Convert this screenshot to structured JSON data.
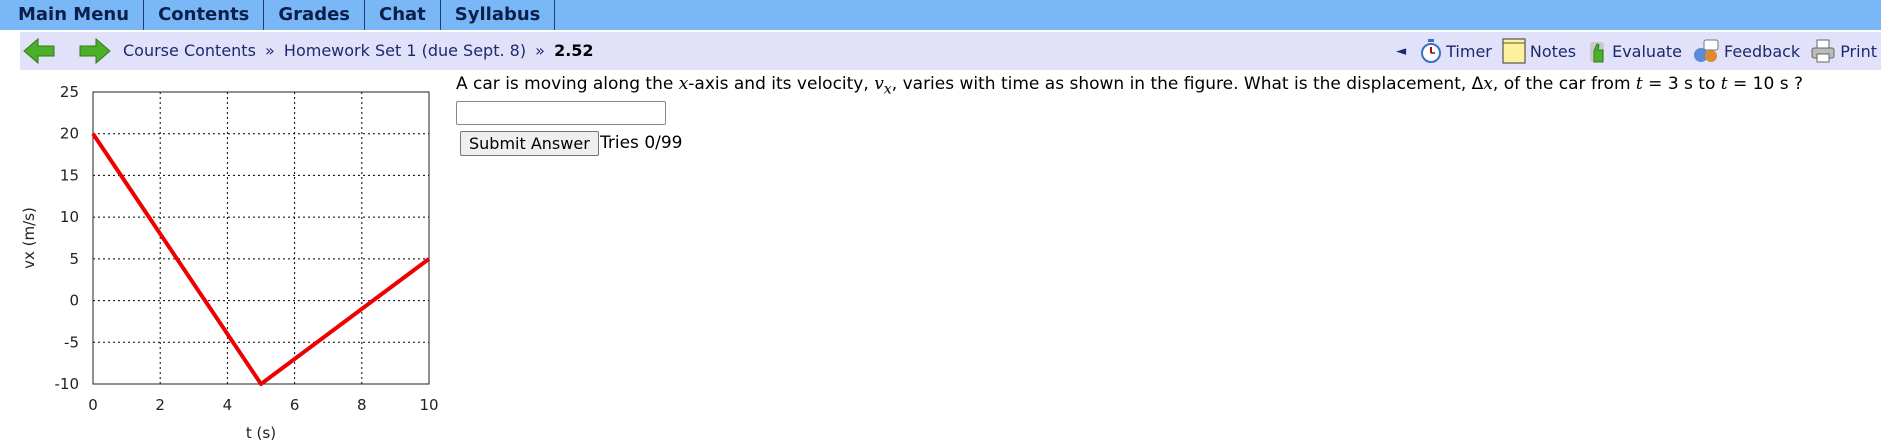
{
  "menu": {
    "items": [
      {
        "label": "Main Menu"
      },
      {
        "label": "Contents"
      },
      {
        "label": "Grades"
      },
      {
        "label": "Chat"
      },
      {
        "label": "Syllabus"
      }
    ]
  },
  "breadcrumb": {
    "root": "Course Contents",
    "separator": "»",
    "section": "Homework Set 1 (due Sept. 8)",
    "current": "2.52"
  },
  "tools": {
    "collapse": "◄",
    "timer": "Timer",
    "notes": "Notes",
    "evaluate": "Evaluate",
    "feedback": "Feedback",
    "print": "Print"
  },
  "question": {
    "part1": "A car is moving along the ",
    "var_x": "x",
    "part2": "-axis and its velocity, ",
    "var_vx": "v",
    "var_vx_sub": "x",
    "part3": ", varies with time as shown in the figure. What is the displacement, Δ",
    "var_dx": "x",
    "part4": ", of the car from ",
    "var_t1": "t",
    "part5": " = 3 s to ",
    "var_t2": "t",
    "part6": " = 10 s ?",
    "submit_label": "Submit Answer",
    "tries": "Tries 0/99",
    "answer_value": ""
  },
  "chart_data": {
    "type": "line",
    "xlabel": "t (s)",
    "ylabel": "vx (m/s)",
    "xlim": [
      0,
      10
    ],
    "ylim": [
      -10,
      25
    ],
    "xticks": [
      0,
      2,
      4,
      6,
      8,
      10
    ],
    "yticks": [
      -10,
      -5,
      0,
      5,
      10,
      15,
      20,
      25
    ],
    "grid": true,
    "series": [
      {
        "x": [
          0,
          5,
          10
        ],
        "y": [
          20,
          -10,
          5
        ],
        "color": "#ee0000"
      }
    ]
  }
}
